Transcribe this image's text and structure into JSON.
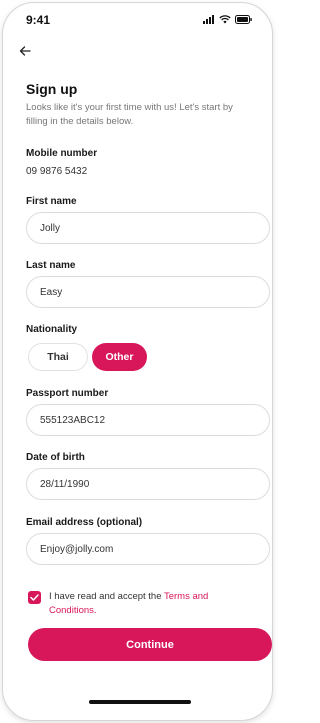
{
  "status_bar": {
    "time": "9:41"
  },
  "header": {
    "title": "Sign up",
    "subtitle": "Looks like it's your first time with us! Let's start by filling in the details below."
  },
  "form": {
    "mobile": {
      "label": "Mobile number",
      "value": "09 9876 5432"
    },
    "first_name": {
      "label": "First name",
      "value": "Jolly"
    },
    "last_name": {
      "label": "Last name",
      "value": "Easy"
    },
    "nationality": {
      "label": "Nationality",
      "options": [
        "Thai",
        "Other"
      ],
      "selected": "Other"
    },
    "passport": {
      "label": "Passport number",
      "value": "555123ABC12"
    },
    "dob": {
      "label": "Date of birth",
      "value": "28/11/1990"
    },
    "email": {
      "label": "Email address (optional)",
      "value": "Enjoy@jolly.com"
    },
    "terms": {
      "checked": true,
      "text": "I have read and accept the ",
      "link": "Terms and Conditions."
    },
    "continue_label": "Continue"
  },
  "colors": {
    "accent": "#d8175a",
    "border": "#dcdcdc",
    "text": "#1a1a1a"
  },
  "icons": {
    "back": "arrow-left-icon",
    "signal": "signal-icon",
    "wifi": "wifi-icon",
    "battery": "battery-icon",
    "check": "check-icon"
  }
}
